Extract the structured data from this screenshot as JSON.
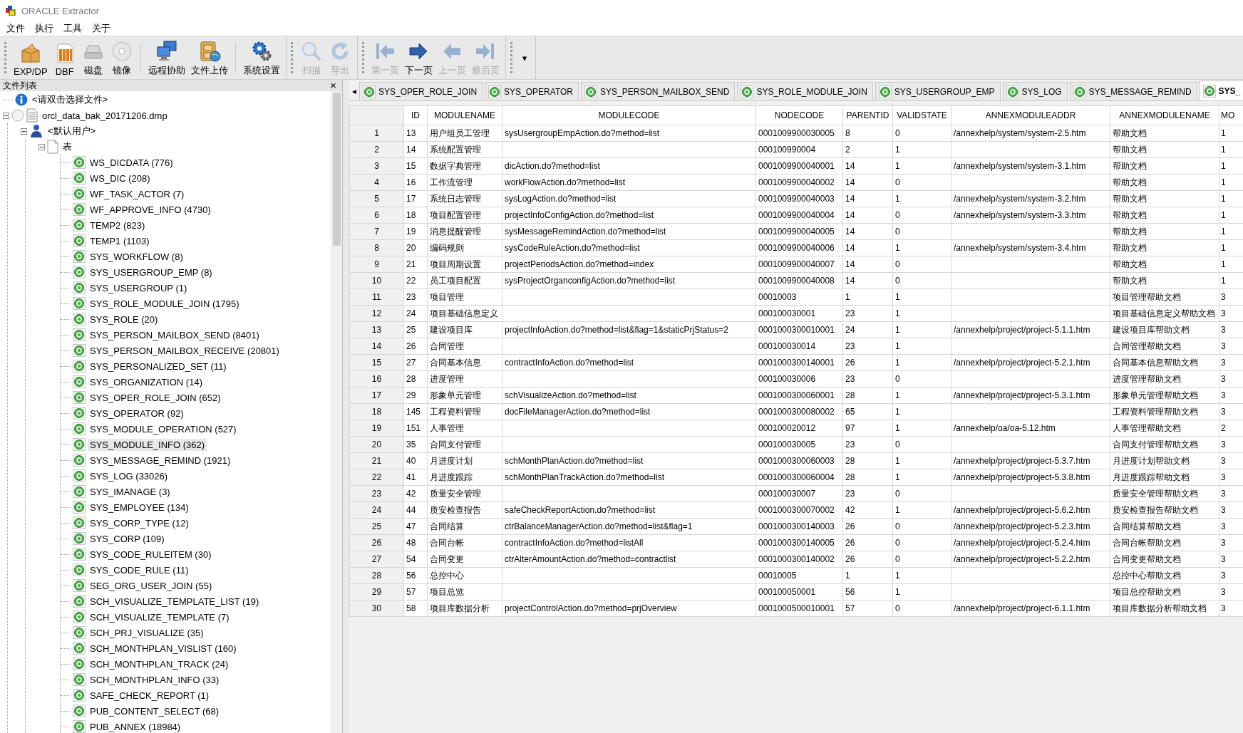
{
  "window": {
    "title": "ORACLE Extractor"
  },
  "menu": [
    "文件",
    "执行",
    "工具",
    "关于"
  ],
  "toolbar": {
    "bands": [
      {
        "groups": [
          {
            "items": [
              {
                "label": "EXP/DP",
                "disabled": false
              },
              {
                "label": "DBF",
                "disabled": false
              },
              {
                "label": "磁盘",
                "disabled": false
              },
              {
                "label": "镜像",
                "disabled": false
              }
            ]
          },
          {
            "items": [
              {
                "label": "远程协助",
                "disabled": false
              },
              {
                "label": "文件上传",
                "disabled": false
              }
            ]
          },
          {
            "items": [
              {
                "label": "系统设置",
                "disabled": false
              }
            ]
          }
        ]
      },
      {
        "groups": [
          {
            "items": [
              {
                "label": "扫描",
                "disabled": true
              },
              {
                "label": "导出",
                "disabled": true
              }
            ]
          }
        ]
      },
      {
        "groups": [
          {
            "items": [
              {
                "label": "第一页",
                "disabled": true
              },
              {
                "label": "下一页",
                "disabled": false
              },
              {
                "label": "上一页",
                "disabled": true
              },
              {
                "label": "最后页",
                "disabled": true
              }
            ]
          }
        ]
      }
    ],
    "overflow": "▾"
  },
  "file_panel": {
    "title": "文件列表",
    "close": "×"
  },
  "tree": [
    {
      "kind": "info",
      "label": "<请双击选择文件>",
      "selected": false
    },
    {
      "kind": "file",
      "label": "orcl_data_bak_20171206.dmp",
      "selected": false,
      "expanded": true,
      "children": [
        {
          "kind": "user",
          "label": "<默认用户>",
          "selected": false,
          "expanded": true,
          "children": [
            {
              "kind": "folder",
              "label": "表",
              "selected": false,
              "expanded": true,
              "children": [
                {
                  "kind": "table",
                  "label": "WS_DICDATA (776)",
                  "selected": false
                },
                {
                  "kind": "table",
                  "label": "WS_DIC (208)",
                  "selected": false
                },
                {
                  "kind": "table",
                  "label": "WF_TASK_ACTOR (7)",
                  "selected": false
                },
                {
                  "kind": "table",
                  "label": "WF_APPROVE_INFO (4730)",
                  "selected": false
                },
                {
                  "kind": "table",
                  "label": "TEMP2 (823)",
                  "selected": false
                },
                {
                  "kind": "table",
                  "label": "TEMP1 (1103)",
                  "selected": false
                },
                {
                  "kind": "table",
                  "label": "SYS_WORKFLOW (8)",
                  "selected": false
                },
                {
                  "kind": "table",
                  "label": "SYS_USERGROUP_EMP (8)",
                  "selected": false
                },
                {
                  "kind": "table",
                  "label": "SYS_USERGROUP (1)",
                  "selected": false
                },
                {
                  "kind": "table",
                  "label": "SYS_ROLE_MODULE_JOIN (1795)",
                  "selected": false
                },
                {
                  "kind": "table",
                  "label": "SYS_ROLE (20)",
                  "selected": false
                },
                {
                  "kind": "table",
                  "label": "SYS_PERSON_MAILBOX_SEND (8401)",
                  "selected": false
                },
                {
                  "kind": "table",
                  "label": "SYS_PERSON_MAILBOX_RECEIVE (20801)",
                  "selected": false
                },
                {
                  "kind": "table",
                  "label": "SYS_PERSONALIZED_SET (11)",
                  "selected": false
                },
                {
                  "kind": "table",
                  "label": "SYS_ORGANIZATION (14)",
                  "selected": false
                },
                {
                  "kind": "table",
                  "label": "SYS_OPER_ROLE_JOIN (652)",
                  "selected": false
                },
                {
                  "kind": "table",
                  "label": "SYS_OPERATOR (92)",
                  "selected": false
                },
                {
                  "kind": "table",
                  "label": "SYS_MODULE_OPERATION (527)",
                  "selected": false
                },
                {
                  "kind": "table",
                  "label": "SYS_MODULE_INFO (362)",
                  "selected": true
                },
                {
                  "kind": "table",
                  "label": "SYS_MESSAGE_REMIND (1921)",
                  "selected": false
                },
                {
                  "kind": "table",
                  "label": "SYS_LOG (33026)",
                  "selected": false
                },
                {
                  "kind": "table",
                  "label": "SYS_IMANAGE (3)",
                  "selected": false
                },
                {
                  "kind": "table",
                  "label": "SYS_EMPLOYEE (134)",
                  "selected": false
                },
                {
                  "kind": "table",
                  "label": "SYS_CORP_TYPE (12)",
                  "selected": false
                },
                {
                  "kind": "table",
                  "label": "SYS_CORP (109)",
                  "selected": false
                },
                {
                  "kind": "table",
                  "label": "SYS_CODE_RULEITEM (30)",
                  "selected": false
                },
                {
                  "kind": "table",
                  "label": "SYS_CODE_RULE (11)",
                  "selected": false
                },
                {
                  "kind": "table",
                  "label": "SEG_ORG_USER_JOIN (55)",
                  "selected": false
                },
                {
                  "kind": "table",
                  "label": "SCH_VISUALIZE_TEMPLATE_LIST (19)",
                  "selected": false
                },
                {
                  "kind": "table",
                  "label": "SCH_VISUALIZE_TEMPLATE (7)",
                  "selected": false
                },
                {
                  "kind": "table",
                  "label": "SCH_PRJ_VISUALIZE (35)",
                  "selected": false
                },
                {
                  "kind": "table",
                  "label": "SCH_MONTHPLAN_VISLIST (160)",
                  "selected": false
                },
                {
                  "kind": "table",
                  "label": "SCH_MONTHPLAN_TRACK (24)",
                  "selected": false
                },
                {
                  "kind": "table",
                  "label": "SCH_MONTHPLAN_INFO (33)",
                  "selected": false
                },
                {
                  "kind": "table",
                  "label": "SAFE_CHECK_REPORT (1)",
                  "selected": false
                },
                {
                  "kind": "table",
                  "label": "PUB_CONTENT_SELECT (68)",
                  "selected": false
                },
                {
                  "kind": "table",
                  "label": "PUB_ANNEX (18984)",
                  "selected": false
                }
              ]
            }
          ]
        }
      ]
    }
  ],
  "tab_scroll": "◂",
  "tabs": [
    {
      "label": "SYS_OPER_ROLE_JOIN",
      "selected": false
    },
    {
      "label": "SYS_OPERATOR",
      "selected": false
    },
    {
      "label": "SYS_PERSON_MAILBOX_SEND",
      "selected": false
    },
    {
      "label": "SYS_ROLE_MODULE_JOIN",
      "selected": false
    },
    {
      "label": "SYS_USERGROUP_EMP",
      "selected": false
    },
    {
      "label": "SYS_LOG",
      "selected": false
    },
    {
      "label": "SYS_MESSAGE_REMIND",
      "selected": false
    },
    {
      "label": "SYS_",
      "selected": true
    }
  ],
  "table": {
    "columns": [
      "ID",
      "MODULENAME",
      "MODULECODE",
      "NODECODE",
      "PARENTID",
      "VALIDSTATE",
      "ANNEXMODULEADDR",
      "ANNEXMODULENAME",
      "MO"
    ],
    "rows": [
      {
        "number": "1",
        "cells": [
          "13",
          "用户组员工管理",
          "sysUsergroupEmpAction.do?method=list",
          "0001009900030005",
          "8",
          "0",
          "/annexhelp/system/system-2.5.htm",
          "帮助文档",
          "1"
        ]
      },
      {
        "number": "2",
        "cells": [
          "14",
          "系统配置管理",
          null,
          "000100990004",
          "2",
          "1",
          null,
          "帮助文档",
          "1"
        ]
      },
      {
        "number": "3",
        "cells": [
          "15",
          "数据字典管理",
          "dicAction.do?method=list",
          "0001009900040001",
          "14",
          "1",
          "/annexhelp/system/system-3.1.htm",
          "帮助文档",
          "1"
        ]
      },
      {
        "number": "4",
        "cells": [
          "16",
          "工作流管理",
          "workFlowAction.do?method=list",
          "0001009900040002",
          "14",
          "0",
          null,
          "帮助文档",
          "1"
        ]
      },
      {
        "number": "5",
        "cells": [
          "17",
          "系统日志管理",
          "sysLogAction.do?method=list",
          "0001009900040003",
          "14",
          "1",
          "/annexhelp/system/system-3.2.htm",
          "帮助文档",
          "1"
        ]
      },
      {
        "number": "6",
        "cells": [
          "18",
          "项目配置管理",
          "projectInfoConfigAction.do?method=list",
          "0001009900040004",
          "14",
          "0",
          "/annexhelp/system/system-3.3.htm",
          "帮助文档",
          "1"
        ]
      },
      {
        "number": "7",
        "cells": [
          "19",
          "消息提醒管理",
          "sysMessageRemindAction.do?method=list",
          "0001009900040005",
          "14",
          "0",
          null,
          "帮助文档",
          "1"
        ]
      },
      {
        "number": "8",
        "cells": [
          "20",
          "编码规则",
          "sysCodeRuleAction.do?method=list",
          "0001009900040006",
          "14",
          "1",
          "/annexhelp/system/system-3.4.htm",
          "帮助文档",
          "1"
        ]
      },
      {
        "number": "9",
        "cells": [
          "21",
          "项目周期设置",
          "projectPeriodsAction.do?method=index",
          "0001009900040007",
          "14",
          "0",
          null,
          "帮助文档",
          "1"
        ]
      },
      {
        "number": "10",
        "cells": [
          "22",
          "员工项目配置",
          "sysProjectOrganconfigAction.do?method=list",
          "0001009900040008",
          "14",
          "0",
          null,
          "帮助文档",
          "1"
        ]
      },
      {
        "number": "11",
        "cells": [
          "23",
          "项目管理",
          null,
          "00010003",
          "1",
          "1",
          null,
          "项目管理帮助文档",
          "3"
        ]
      },
      {
        "number": "12",
        "cells": [
          "24",
          "项目基础信息定义",
          null,
          "000100030001",
          "23",
          "1",
          null,
          "项目基础信息定义帮助文档",
          "3"
        ]
      },
      {
        "number": "13",
        "cells": [
          "25",
          "建设项目库",
          "projectInfoAction.do?method=list&flag=1&staticPrjStatus=2",
          "0001000300010001",
          "24",
          "1",
          "/annexhelp/project/project-5.1.1.htm",
          "建设项目库帮助文档",
          "3"
        ]
      },
      {
        "number": "14",
        "cells": [
          "26",
          "合同管理",
          null,
          "000100030014",
          "23",
          "1",
          null,
          "合同管理帮助文档",
          "3"
        ]
      },
      {
        "number": "15",
        "cells": [
          "27",
          "合同基本信息",
          "contractInfoAction.do?method=list",
          "0001000300140001",
          "26",
          "1",
          "/annexhelp/project/project-5.2.1.htm",
          "合同基本信息帮助文档",
          "3"
        ]
      },
      {
        "number": "16",
        "cells": [
          "28",
          "进度管理",
          null,
          "000100030006",
          "23",
          "0",
          null,
          "进度管理帮助文档",
          "3"
        ]
      },
      {
        "number": "17",
        "cells": [
          "29",
          "形象单元管理",
          "schVisualizeAction.do?method=list",
          "0001000300060001",
          "28",
          "1",
          "/annexhelp/project/project-5.3.1.htm",
          "形象单元管理帮助文档",
          "3"
        ]
      },
      {
        "number": "18",
        "cells": [
          "145",
          "工程资料管理",
          "docFileManagerAction.do?method=list",
          "0001000300080002",
          "65",
          "1",
          null,
          "工程资料管理帮助文档",
          "3"
        ]
      },
      {
        "number": "19",
        "cells": [
          "151",
          "人事管理",
          null,
          "000100020012",
          "97",
          "1",
          "/annexhelp/oa/oa-5.12.htm",
          "人事管理帮助文档",
          "2"
        ]
      },
      {
        "number": "20",
        "cells": [
          "35",
          "合同支付管理",
          null,
          "000100030005",
          "23",
          "0",
          null,
          "合同支付管理帮助文档",
          "3"
        ]
      },
      {
        "number": "21",
        "cells": [
          "40",
          "月进度计划",
          "schMonthPlanAction.do?method=list",
          "0001000300060003",
          "28",
          "1",
          "/annexhelp/project/project-5.3.7.htm",
          "月进度计划帮助文档",
          "3"
        ]
      },
      {
        "number": "22",
        "cells": [
          "41",
          "月进度跟踪",
          "schMonthPlanTrackAction.do?method=list",
          "0001000300060004",
          "28",
          "1",
          "/annexhelp/project/project-5.3.8.htm",
          "月进度跟踪帮助文档",
          "3"
        ]
      },
      {
        "number": "23",
        "cells": [
          "42",
          "质量安全管理",
          null,
          "000100030007",
          "23",
          "0",
          null,
          "质量安全管理帮助文档",
          "3"
        ]
      },
      {
        "number": "24",
        "cells": [
          "44",
          "质安检查报告",
          "safeCheckReportAction.do?method=list",
          "0001000300070002",
          "42",
          "1",
          "/annexhelp/project/project-5.6.2.htm",
          "质安检查报告帮助文档",
          "3"
        ]
      },
      {
        "number": "25",
        "cells": [
          "47",
          "合同结算",
          "ctrBalanceManagerAction.do?method=list&flag=1",
          "0001000300140003",
          "26",
          "0",
          "/annexhelp/project/project-5.2.3.htm",
          "合同结算帮助文档",
          "3"
        ]
      },
      {
        "number": "26",
        "cells": [
          "48",
          "合同台帐",
          "contractInfoAction.do?method=listAll",
          "0001000300140005",
          "26",
          "0",
          "/annexhelp/project/project-5.2.4.htm",
          "合同台帐帮助文档",
          "3"
        ]
      },
      {
        "number": "27",
        "cells": [
          "54",
          "合同变更",
          "ctrAlterAmountAction.do?method=contractlist",
          "0001000300140002",
          "26",
          "0",
          "/annexhelp/project/project-5.2.2.htm",
          "合同变更帮助文档",
          "3"
        ]
      },
      {
        "number": "28",
        "cells": [
          "56",
          "总控中心",
          null,
          "00010005",
          "1",
          "1",
          null,
          "总控中心帮助文档",
          "3"
        ]
      },
      {
        "number": "29",
        "cells": [
          "57",
          "项目总览",
          null,
          "000100050001",
          "56",
          "1",
          null,
          "项目总控帮助文档",
          "3"
        ]
      },
      {
        "number": "30",
        "cells": [
          "58",
          "项目库数据分析",
          "projectControlAction.do?method=prjOverview",
          "0001000500010001",
          "57",
          "0",
          "/annexhelp/project/project-6.1.1.htm",
          "项目库数据分析帮助文档",
          "3"
        ]
      }
    ]
  }
}
